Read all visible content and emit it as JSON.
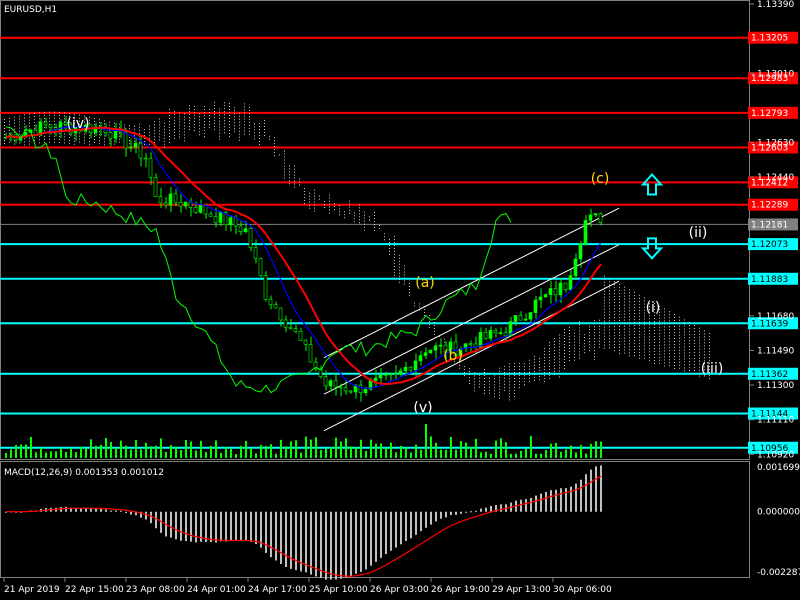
{
  "chart_data": {
    "type": "line",
    "symbol_label": "EURUSD,H1",
    "price_ticks": [
      "1.13390",
      "1.13010",
      "1.12630",
      "1.12440",
      "1.11680",
      "1.11490",
      "1.11300",
      "1.11110",
      "1.10920"
    ],
    "price_range": [
      1.109,
      1.1339
    ],
    "current_price": "1.12181",
    "resistance_levels": [
      {
        "label": "1.13205",
        "value": 1.13205
      },
      {
        "label": "1.12983",
        "value": 1.12983
      },
      {
        "label": "1.12793",
        "value": 1.12793
      },
      {
        "label": "1.12603",
        "value": 1.12603
      },
      {
        "label": "1.12412",
        "value": 1.12412
      },
      {
        "label": "1.12289",
        "value": 1.12289
      }
    ],
    "support_levels": [
      {
        "label": "1.12073",
        "value": 1.12073
      },
      {
        "label": "1.11883",
        "value": 1.11883
      },
      {
        "label": "1.11639",
        "value": 1.11639
      },
      {
        "label": "1.11362",
        "value": 1.11362
      },
      {
        "label": "1.11144",
        "value": 1.11144
      },
      {
        "label": "1.10956",
        "value": 1.10956
      }
    ],
    "wave_labels": [
      {
        "text": "(iv)",
        "color": "#ffffff"
      },
      {
        "text": "(v)",
        "color": "#ffffff"
      },
      {
        "text": "(a)",
        "color": "#ffd700"
      },
      {
        "text": "(b)",
        "color": "#ffd700"
      },
      {
        "text": "(c)",
        "color": "#ffd700"
      },
      {
        "text": "(ii)",
        "color": "#ffffff"
      },
      {
        "text": "(i)",
        "color": "#ffffff"
      },
      {
        "text": "(iii)",
        "color": "#ffffff"
      }
    ],
    "macd_label": "MACD(12,26,9) 0.001353 0.001012",
    "macd_ticks": [
      "0.001699",
      "0.000000",
      "-0.002287"
    ],
    "macd_range": [
      -0.002287,
      0.001699
    ],
    "x_labels": [
      "21 Apr 2019",
      "22 Apr 15:00",
      "23 Apr 08:00",
      "24 Apr 01:00",
      "24 Apr 17:00",
      "25 Apr 10:00",
      "26 Apr 03:00",
      "26 Apr 19:00",
      "29 Apr 13:00",
      "30 Apr 06:00"
    ],
    "colors": {
      "background": "#000000",
      "resistance": "#ff0000",
      "support": "#00ffff",
      "candles": "#00ff00",
      "ma_fast": "#0000ff",
      "ma_slow": "#ff0000",
      "cloud": "#ffffff",
      "channel": "#ffffff",
      "arrow": "#00ffff",
      "macd_hist": "#c0c0c0",
      "macd_signal": "#ff0000"
    },
    "arrows": [
      {
        "direction": "up",
        "value": 1.124
      },
      {
        "direction": "down",
        "value": 1.1205
      }
    ]
  }
}
